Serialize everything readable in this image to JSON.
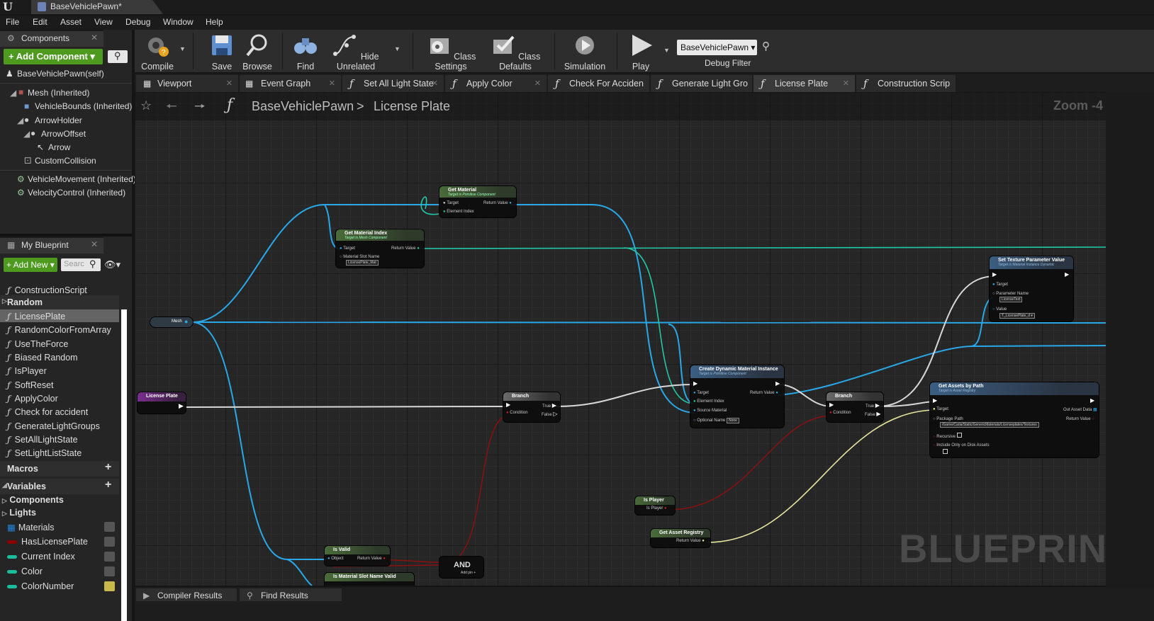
{
  "app": {
    "document_tab": "BaseVehiclePawn*",
    "menu": [
      "File",
      "Edit",
      "Asset",
      "View",
      "Debug",
      "Window",
      "Help"
    ]
  },
  "components_panel": {
    "title": "Components",
    "add_component": "+ Add Component ▾",
    "root": "BaseVehiclePawn(self)",
    "tree": [
      "Mesh (Inherited)",
      "VehicleBounds (Inherited)",
      "ArrowHolder",
      "ArrowOffset",
      "Arrow",
      "CustomCollision",
      "VehicleMovement (Inherited)",
      "VelocityControl (Inherited)"
    ]
  },
  "my_blueprint": {
    "title": "My Blueprint",
    "add_new": "+ Add New ▾",
    "search_placeholder": "Searc",
    "construction_script": "ConstructionScript",
    "random_category": "Random",
    "functions": [
      "LicensePlate",
      "RandomColorFromArray",
      "UseTheForce",
      "Biased Random",
      "IsPlayer",
      "SoftReset",
      "ApplyColor",
      "Check for accident",
      "GenerateLightGroups",
      "SetAllLightState",
      "SetLightListState"
    ],
    "macros": "Macros",
    "variables": "Variables",
    "var_categories": [
      "Components",
      "Lights"
    ],
    "vars": [
      {
        "name": "Materials",
        "color": "#1e88e5"
      },
      {
        "name": "HasLicensePlate",
        "color": "#8b0000"
      },
      {
        "name": "Current Index",
        "color": "#1abc9c"
      },
      {
        "name": "Color",
        "color": "#1abc9c"
      },
      {
        "name": "ColorNumber",
        "color": "#1abc9c"
      }
    ]
  },
  "toolbar": {
    "compile": "Compile",
    "save": "Save",
    "browse": "Browse",
    "find": "Find",
    "hide_unrelated": "Hide Unrelated",
    "class_settings": "Class Settings",
    "class_defaults": "Class Defaults",
    "simulation": "Simulation",
    "play": "Play",
    "debug_object": "BaseVehiclePawn ▾",
    "debug_filter": "Debug Filter"
  },
  "graph_tabs": [
    "Viewport",
    "Event Graph",
    "Set All Light State",
    "Apply Color",
    "Check For Acciden",
    "Generate Light Gro",
    "License Plate",
    "Construction Scrip"
  ],
  "breadcrumb": {
    "parent": "BaseVehiclePawn",
    "sep": ">",
    "current": "License Plate"
  },
  "zoom": "Zoom -4",
  "watermark": "BLUEPRINT",
  "nodes": {
    "get_material": {
      "title": "Get Material",
      "target": "Target is Primitive Component",
      "in1": "Target",
      "in2": "Element Index",
      "out": "Return Value"
    },
    "get_material_index": {
      "title": "Get Material Index",
      "target": "Target is Mesh Component",
      "in1": "Target",
      "in2": "Material Slot Name",
      "value": "LicensePlate_Mat",
      "out": "Return Value"
    },
    "mesh": {
      "title": "Mesh"
    },
    "license_plate": {
      "title": "License Plate"
    },
    "branch1": {
      "title": "Branch",
      "cond": "Condition",
      "t": "True",
      "f": "False"
    },
    "cdmi": {
      "title": "Create Dynamic Material Instance",
      "target": "Target is Primitive Component",
      "in1": "Target",
      "in2": "Element Index",
      "in3": "Source Material",
      "in4": "Optional Name",
      "value": "None",
      "out": "Return Value"
    },
    "branch2": {
      "title": "Branch",
      "cond": "Condition",
      "t": "True",
      "f": "False"
    },
    "set_texture": {
      "title": "Set Texture Parameter Value",
      "target": "Target is Material Instance Dynamic",
      "in1": "Target",
      "in2": "Parameter Name",
      "value": "LicenseText",
      "in3": "Value",
      "value2": "T_LicensePlate_d ▾"
    },
    "get_assets": {
      "title": "Get Assets by Path",
      "target": "Target is Asset Registry",
      "in1": "Target",
      "in2": "Package Path",
      "value": "/Game/Carla/Static/GenericMaterials/Licenseplates/Textures",
      "in3": "Recursive",
      "in4": "Include Only on Disk Assets",
      "out1": "Out Asset Data",
      "out2": "Return Value"
    },
    "is_player": {
      "title": "Is Player",
      "out": "Is Player"
    },
    "get_registry": {
      "title": "Get Asset Registry",
      "out": "Return Value"
    },
    "is_valid": {
      "title": "Is Valid",
      "in": "Object",
      "out": "Return Value"
    },
    "and": {
      "title": "AND",
      "add": "Add pin +"
    },
    "slot_valid": {
      "title": "Is Material Slot Name Valid"
    }
  },
  "bottom_tabs": [
    "Compiler Results",
    "Find Results"
  ]
}
